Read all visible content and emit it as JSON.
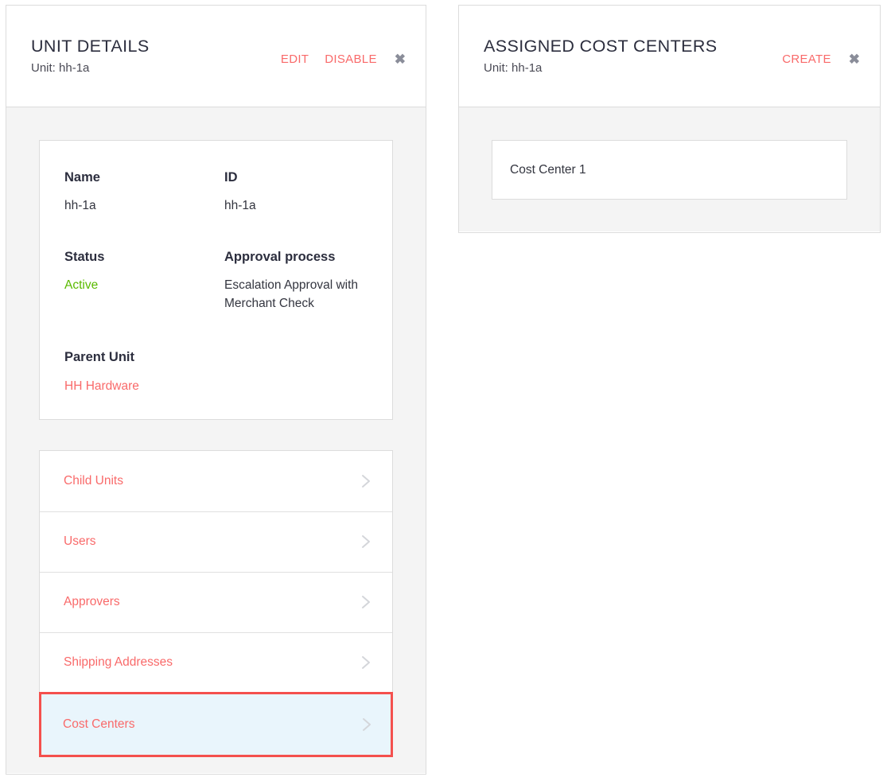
{
  "colors": {
    "accent_red": "#f96a6a",
    "highlight_border": "#f4504d",
    "highlight_bg": "#e9f5fc",
    "status_green": "#5aba00",
    "panel_body_bg": "#f4f4f4",
    "border_gray": "#dcdcdc",
    "text_dark": "#2c2e3e",
    "icon_gray": "#8a8d99"
  },
  "left_panel": {
    "title": "UNIT DETAILS",
    "subtitle": "Unit: hh-1a",
    "actions": [
      {
        "label": "EDIT",
        "name": "edit-link"
      },
      {
        "label": "DISABLE",
        "name": "disable-link"
      }
    ],
    "close_icon": "close-icon",
    "close_glyph": "✖",
    "details": {
      "fields": [
        {
          "label": "Name",
          "value": "hh-1a",
          "style": "plain"
        },
        {
          "label": "ID",
          "value": "hh-1a",
          "style": "plain"
        },
        {
          "label": "Status",
          "value": "Active",
          "style": "green"
        },
        {
          "label": "Approval process",
          "value": "Escalation Approval with Merchant Check",
          "style": "plain"
        },
        {
          "label": "Parent Unit",
          "value": "HH Hardware",
          "style": "link"
        }
      ]
    },
    "nav_items": [
      {
        "label": "Child Units",
        "selected": false,
        "icon": "chevron-right-icon"
      },
      {
        "label": "Users",
        "selected": false,
        "icon": "chevron-right-icon"
      },
      {
        "label": "Approvers",
        "selected": false,
        "icon": "chevron-right-icon"
      },
      {
        "label": "Shipping Addresses",
        "selected": false,
        "icon": "chevron-right-icon"
      },
      {
        "label": "Cost Centers",
        "selected": true,
        "icon": "chevron-right-icon"
      }
    ]
  },
  "right_panel": {
    "title": "ASSIGNED COST CENTERS",
    "subtitle": "Unit: hh-1a",
    "actions": [
      {
        "label": "CREATE",
        "name": "create-link"
      }
    ],
    "close_icon": "close-icon",
    "close_glyph": "✖",
    "cost_centers": [
      {
        "label": "Cost Center 1"
      }
    ]
  }
}
